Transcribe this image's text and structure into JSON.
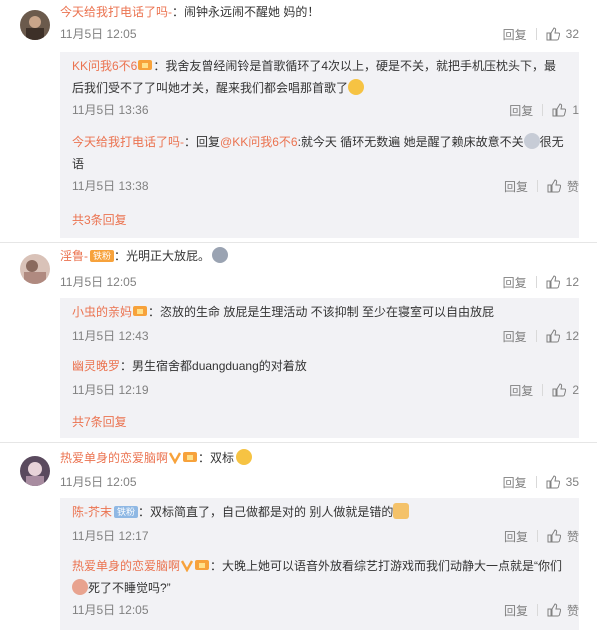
{
  "labels": {
    "reply": "回复",
    "like": "赞"
  },
  "comments": [
    {
      "user": "今天给我打电话了吗-",
      "text": "：闹钟永远闹不醒她 妈的！",
      "time": "11月5日 12:05",
      "likes": "32",
      "replies": [
        {
          "user": "KK问我6不6",
          "text_line1": "：我舍友曾经闹铃是首歌循环了4次以上，硬是不关，就把手机压枕头下，最",
          "text_line2": "后我们受不了了叫她才关，醒来我们都会唱那首歌了",
          "time": "11月5日 13:36",
          "likes": "1"
        },
        {
          "user": "今天给我打电话了吗-",
          "text_pre": "：回复",
          "mention": "@KK问我6不6",
          "text_line1": ":就今天 循环无数遍 她是醒了赖床故意不关",
          "text_tail": "很无",
          "text_line2": "语",
          "time": "11月5日 13:38",
          "likes": "赞"
        }
      ],
      "more": "共3条回复"
    },
    {
      "user": "淫鲁-",
      "fans": "铁粉",
      "text": "：光明正大放屁。",
      "time": "11月5日 12:05",
      "likes": "12",
      "replies": [
        {
          "user": "小虫的亲妈",
          "text": "：恣放的生命 放屁是生理活动 不该抑制 至少在寝室可以自由放屁",
          "time": "11月5日 12:43",
          "likes": "12"
        },
        {
          "user": "幽灵晚罗",
          "text": "：男生宿舍都duangduang的对着放",
          "time": "11月5日 12:19",
          "likes": "2"
        }
      ],
      "more": "共7条回复"
    },
    {
      "user": "热爱单身的恋爱脑啊",
      "text": "：双标",
      "time": "11月5日 12:05",
      "likes": "35",
      "replies": [
        {
          "user": "陈-芥末",
          "fans": "铁粉",
          "text": "：双标简直了，自己做都是对的 别人做就是错的",
          "time": "11月5日 12:17",
          "likes": "赞"
        },
        {
          "user": "热爱单身的恋爱脑啊",
          "text_line1": "：大晚上她可以语音外放看综艺打游戏而我们动静大一点就是“你们",
          "text_line2": "死了不睡觉吗?”",
          "time": "11月5日 12:05",
          "likes": "赞"
        }
      ]
    }
  ]
}
